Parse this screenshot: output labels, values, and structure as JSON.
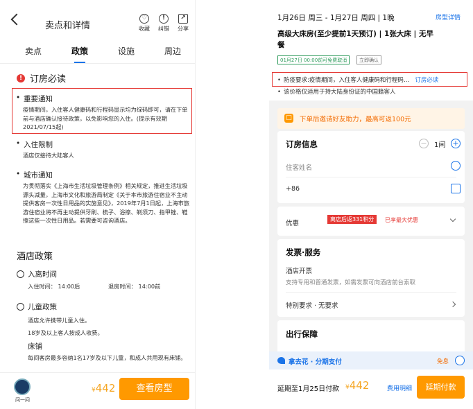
{
  "left": {
    "title": "卖点和详情",
    "actions": [
      {
        "label": "收藏",
        "icon": "heart-icon",
        "glyph": "♡"
      },
      {
        "label": "纠错",
        "icon": "info-icon",
        "glyph": "!"
      },
      {
        "label": "分享",
        "icon": "share-icon",
        "glyph": "↗"
      }
    ],
    "tabs": [
      "卖点",
      "政策",
      "设施",
      "周边"
    ],
    "active_tab": "政策",
    "booking_title": "订房必读",
    "important": {
      "title": "重要通知",
      "body": "疫情期间，入住客人健康码和行程码显示均为绿码即可，请在下单前与酒店确认接待政策，以免影响您的入住。(提示有效期2021/07/15起)"
    },
    "checkin_limit": {
      "title": "入住限制",
      "body": "酒店仅接待大陆客人"
    },
    "city_notice": {
      "title": "城市通知",
      "body": "为贯彻落实《上海市生活垃圾管理条例》相关规定，推进生活垃圾源头减量，上海市文化和旅游局制定《关于本市旅游住宿业不主动提供客房一次性日用品的实施意见》，2019年7月1日起，上海市旅游住宿业将不再主动提供牙刷、梳子、浴擦、剃须刀、指甲锉、鞋擦这些一次性日用品。若需要可咨询酒店。"
    },
    "policy_title": "酒店政策",
    "in_out": {
      "title": "入离时间",
      "checkin": "入住时间：  14:00后",
      "checkout": "退房时间：  14:00前"
    },
    "child": {
      "title": "儿童政策",
      "line1": "酒店允许携带儿童入住。",
      "line2": "18岁及以上客人按成人收费。",
      "bed_title": "床铺",
      "bed_body": "每间客房最多容纳1名17岁及以下儿童，和成人共用现有床铺。"
    },
    "assistant_label": "问一问",
    "price_symbol": "¥",
    "price": "442",
    "cta": "查看房型"
  },
  "right": {
    "date_line": "1月26日 周三 - 1月27日 周四  | 1晚",
    "room_detail_link": "房型详情",
    "room_line1": "高级大床房(至少提前1天预订) | 1张大床 | 无早",
    "room_line2": "餐",
    "free_cancel": "01月27日 00:00前可免费取消",
    "instant_confirm": "立即确认",
    "epidemic_note": "防疫要求:疫情期间，入住客人健康码和行程码…",
    "must_read_link": "订房必读",
    "id_note": "该价格仅适用于持大陆身份证的中国籍客人",
    "promo": "下单后邀请好友助力，最高可返100元",
    "booking_info_title": "订房信息",
    "rooms_count": "1间",
    "guest_name_label": "住客姓名",
    "phone_prefix": "+86",
    "discount_label": "优惠",
    "discount_tag": "离店后返331积分",
    "discount_note": "已享最大优惠",
    "invoice_title": "发票·服务",
    "hotel_invoice": "酒店开票",
    "invoice_desc": "支持专用和普通发票，如需发票可向酒店前台索取",
    "special_req": "特别要求 · 无要求",
    "travel_title": "出行保障",
    "pay_method": "拿去花 · 分期支付",
    "free_interest": "免息",
    "deferred": "延期至1月25日付款",
    "price_symbol": "¥",
    "price": "442",
    "fee_detail": "费用明细",
    "pay_btn": "延期付款"
  }
}
